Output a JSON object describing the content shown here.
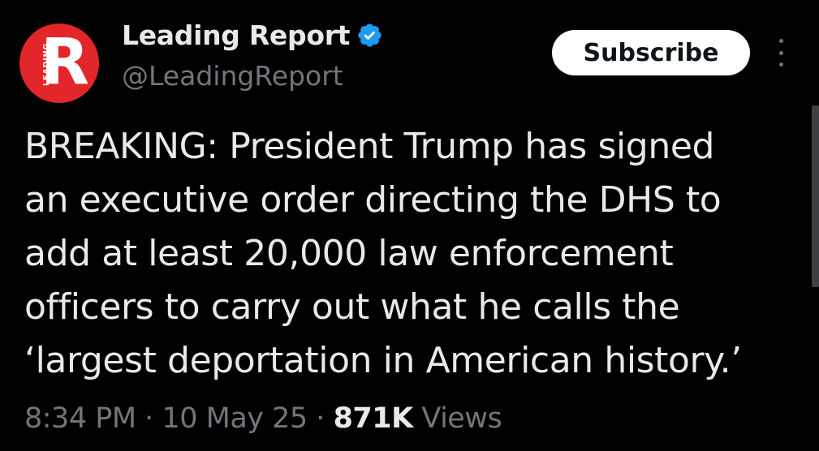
{
  "author": {
    "avatar_letter": "R",
    "avatar_vertical_text": "LEADING",
    "display_name": "Leading Report",
    "handle": "@LeadingReport",
    "verified_icon": "verified-badge-icon",
    "avatar_color": "#e3262a",
    "verified_color": "#1d9bf0"
  },
  "actions": {
    "subscribe_label": "Subscribe",
    "more_icon": "more-vertical-icon"
  },
  "tweet": {
    "lines": [
      "BREAKING: President Trump has signed",
      "an executive order directing the DHS to",
      "add at least 20,000 law enforcement",
      "officers to carry out what he calls the",
      "‘largest deportation in American history.’"
    ]
  },
  "meta": {
    "time": "8:34 PM",
    "separator": "·",
    "date": "10 May 25",
    "views_count": "871K",
    "views_label": "Views"
  }
}
